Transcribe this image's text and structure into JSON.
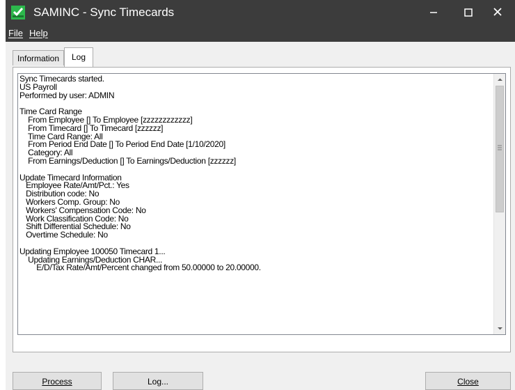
{
  "window": {
    "title": "SAMINC - Sync Timecards"
  },
  "menu": {
    "file": "File",
    "help": "Help"
  },
  "tabs": {
    "information": "Information",
    "log": "Log"
  },
  "log": [
    "Sync Timecards started.",
    "US Payroll",
    "Performed by user: ADMIN",
    "",
    "Time Card Range",
    "    From Employee [] To Employee [zzzzzzzzzzzz]",
    "    From Timecard [] To Timecard [zzzzzz]",
    "    Time Card Range: All",
    "    From Period End Date [] To Period End Date [1/10/2020]",
    "    Category: All",
    "    From Earnings/Deduction [] To Earnings/Deduction [zzzzzz]",
    "",
    "Update Timecard Information",
    "   Employee Rate/Amt/Pct.: Yes",
    "   Distribution code: No",
    "   Workers Comp. Group: No",
    "   Workers' Compensation Code: No",
    "   Work Classification Code: No",
    "   Shift Differential Schedule: No",
    "   Overtime Schedule: No",
    "",
    "Updating Employee 100050 Timecard 1...",
    "    Updating Earnings/Deduction CHAR...",
    "        E/D/Tax Rate/Amt/Percent changed from 50.00000 to 20.00000."
  ],
  "buttons": {
    "process": "Process",
    "log": "Log...",
    "close": "Close"
  },
  "colors": {
    "titlebar": "#3c3c3c",
    "app_icon": "#2db84c",
    "panel": "#f0f0f0"
  }
}
